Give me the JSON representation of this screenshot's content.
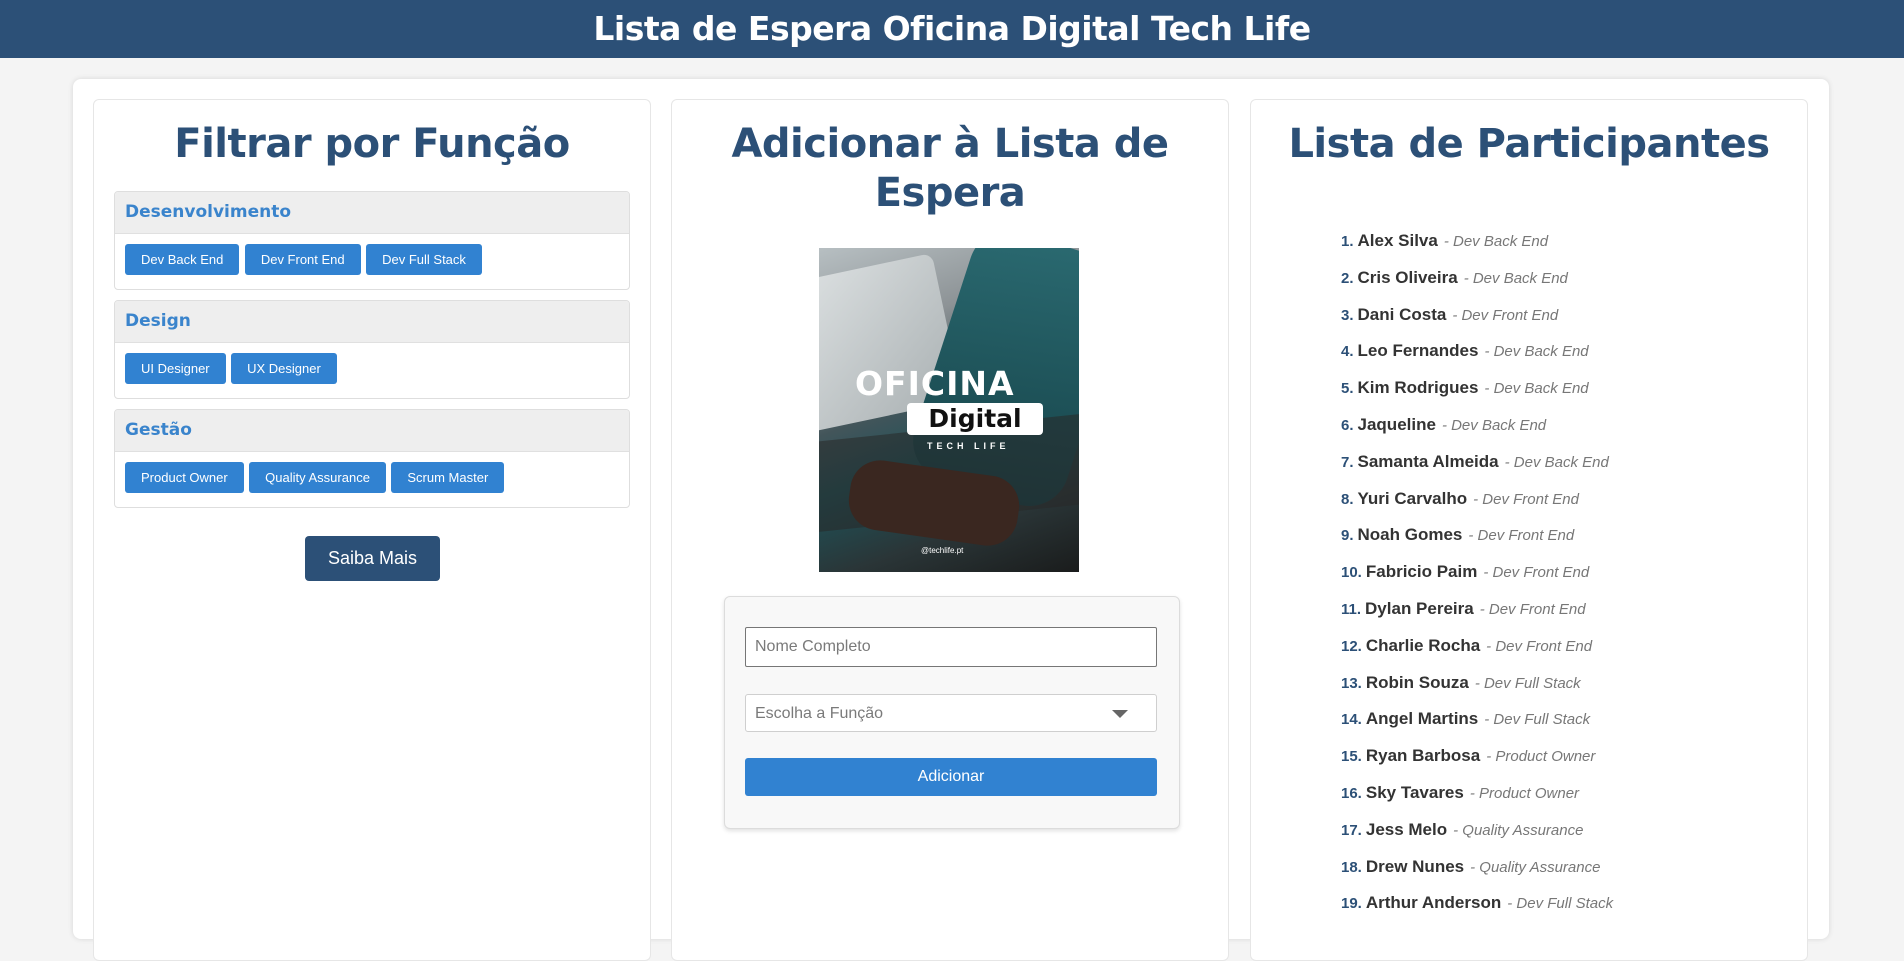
{
  "header": {
    "title": "Lista de Espera Oficina Digital Tech Life"
  },
  "filter_panel": {
    "title": "Filtrar por Função",
    "groups": [
      {
        "label": "Desenvolvimento",
        "buttons": [
          "Dev Back End",
          "Dev Front End",
          "Dev Full Stack"
        ]
      },
      {
        "label": "Design",
        "buttons": [
          "UI Designer",
          "UX Designer"
        ]
      },
      {
        "label": "Gestão",
        "buttons": [
          "Product Owner",
          "Quality Assurance",
          "Scrum Master"
        ]
      }
    ],
    "more_button": "Saiba Mais"
  },
  "add_panel": {
    "title": "Adicionar à Lista de Espera",
    "poster": {
      "title": "OFICINA",
      "badge": "Digital",
      "subtitle": "TECH LIFE",
      "handle": "@techlife.pt"
    },
    "name_placeholder": "Nome Completo",
    "role_placeholder": "Escolha a Função",
    "add_button": "Adicionar"
  },
  "list_panel": {
    "title": "Lista de Participantes",
    "participants": [
      {
        "num": "1.",
        "name": "Alex Silva",
        "role": "- Dev Back End"
      },
      {
        "num": "2.",
        "name": "Cris Oliveira",
        "role": "- Dev Back End"
      },
      {
        "num": "3.",
        "name": "Dani Costa",
        "role": "- Dev Front End"
      },
      {
        "num": "4.",
        "name": "Leo Fernandes",
        "role": "- Dev Back End"
      },
      {
        "num": "5.",
        "name": "Kim Rodrigues",
        "role": "- Dev Back End"
      },
      {
        "num": "6.",
        "name": "Jaqueline",
        "role": "- Dev Back End"
      },
      {
        "num": "7.",
        "name": "Samanta Almeida",
        "role": "- Dev Back End"
      },
      {
        "num": "8.",
        "name": "Yuri Carvalho",
        "role": "- Dev Front End"
      },
      {
        "num": "9.",
        "name": "Noah Gomes",
        "role": "- Dev Front End"
      },
      {
        "num": "10.",
        "name": "Fabricio Paim",
        "role": "- Dev Front End"
      },
      {
        "num": "11.",
        "name": "Dylan Pereira",
        "role": "- Dev Front End"
      },
      {
        "num": "12.",
        "name": "Charlie Rocha",
        "role": "- Dev Front End"
      },
      {
        "num": "13.",
        "name": "Robin Souza",
        "role": "- Dev Full Stack"
      },
      {
        "num": "14.",
        "name": "Angel Martins",
        "role": "- Dev Full Stack"
      },
      {
        "num": "15.",
        "name": "Ryan Barbosa",
        "role": "- Product Owner"
      },
      {
        "num": "16.",
        "name": "Sky Tavares",
        "role": "- Product Owner"
      },
      {
        "num": "17.",
        "name": "Jess Melo",
        "role": "- Quality Assurance"
      },
      {
        "num": "18.",
        "name": "Drew Nunes",
        "role": "- Quality Assurance"
      },
      {
        "num": "19.",
        "name": "Arthur Anderson",
        "role": "- Dev Full Stack"
      }
    ]
  },
  "colors": {
    "primary": "#2c5077",
    "accent": "#3182d1"
  }
}
